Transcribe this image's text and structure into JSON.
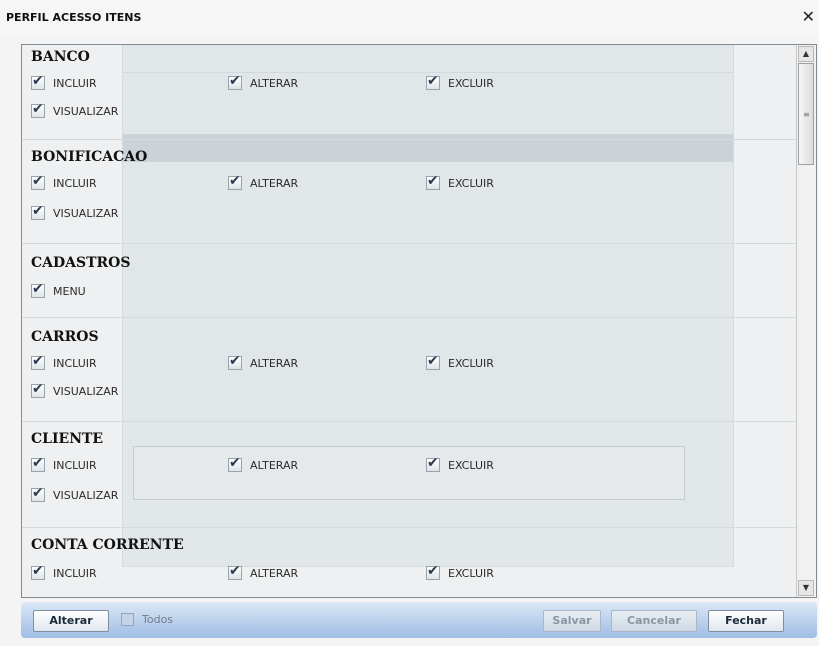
{
  "window": {
    "title": "PERFIL ACESSO ITENS",
    "close_symbol": "✕"
  },
  "sections": [
    {
      "name": "BANCO",
      "options": [
        "INCLUIR",
        "ALTERAR",
        "EXCLUIR",
        "VISUALIZAR"
      ]
    },
    {
      "name": "BONIFICACAO",
      "options": [
        "INCLUIR",
        "ALTERAR",
        "EXCLUIR",
        "VISUALIZAR"
      ]
    },
    {
      "name": "CADASTROS",
      "options": [
        "MENU"
      ]
    },
    {
      "name": "CARROS",
      "options": [
        "INCLUIR",
        "ALTERAR",
        "EXCLUIR",
        "VISUALIZAR"
      ]
    },
    {
      "name": "CLIENTE",
      "options": [
        "INCLUIR",
        "ALTERAR",
        "EXCLUIR",
        "VISUALIZAR"
      ]
    },
    {
      "name": "CONTA CORRENTE",
      "options": [
        "INCLUIR",
        "ALTERAR",
        "EXCLUIR"
      ]
    }
  ],
  "footer": {
    "alterar": "Alterar",
    "todos": "Todos",
    "salvar": "Salvar",
    "cancelar": "Cancelar",
    "fechar": "Fechar"
  },
  "icons": {
    "check": "check-icon",
    "scroll_up": "▲",
    "scroll_down": "▼",
    "grip": "≡"
  }
}
